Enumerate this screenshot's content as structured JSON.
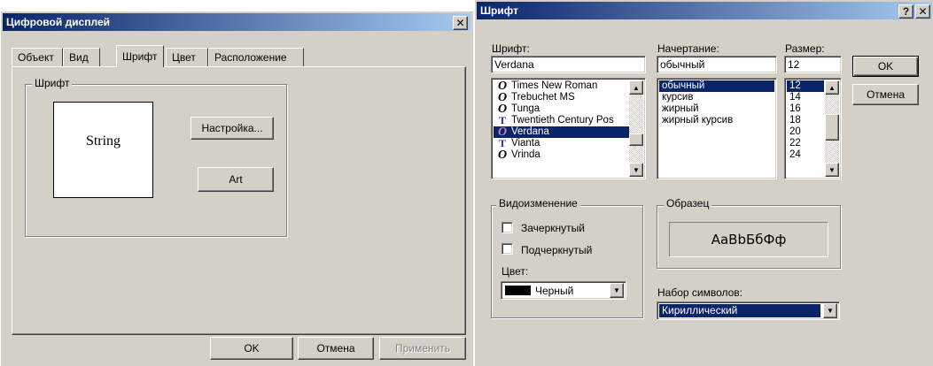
{
  "left_dialog": {
    "title": "Цифровой дисплей",
    "close_glyph": "✕",
    "tabs": [
      {
        "label": "Объект"
      },
      {
        "label": "Вид"
      },
      {
        "label": "Шрифт"
      },
      {
        "label": "Цвет"
      },
      {
        "label": "Расположение"
      }
    ],
    "active_tab": "Шрифт",
    "group_label": "Шрифт",
    "preview_text": "String",
    "setup_button": "Настройка...",
    "art_button": "Art",
    "ok_button": "OK",
    "cancel_button": "Отмена",
    "apply_button": "Применить"
  },
  "right_dialog": {
    "title": "Шрифт",
    "help_glyph": "?",
    "close_glyph": "✕",
    "font_label": "Шрифт:",
    "font_value": "Verdana",
    "fonts": [
      {
        "icon": "O",
        "type": "opentype",
        "name": "Times New Roman"
      },
      {
        "icon": "O",
        "type": "opentype",
        "name": "Trebuchet MS"
      },
      {
        "icon": "O",
        "type": "opentype",
        "name": "Tunga"
      },
      {
        "icon": "T",
        "type": "truetype",
        "name": "Twentieth Century Pos"
      },
      {
        "icon": "O",
        "type": "opentype",
        "name": "Verdana"
      },
      {
        "icon": "T",
        "type": "truetype",
        "name": "Vianta"
      },
      {
        "icon": "O",
        "type": "opentype",
        "name": "Vrinda"
      }
    ],
    "selected_font": "Verdana",
    "style_label": "Начертание:",
    "style_value": "обычный",
    "styles": [
      "обычный",
      "курсив",
      "жирный",
      "жирный курсив"
    ],
    "selected_style": "обычный",
    "size_label": "Размер:",
    "size_value": "12",
    "sizes": [
      "12",
      "14",
      "16",
      "18",
      "20",
      "22",
      "24"
    ],
    "selected_size": "12",
    "ok_button": "OK",
    "cancel_button": "Отмена",
    "effects_label": "Видоизменение",
    "strikeout_label": "Зачеркнутый",
    "underline_label": "Подчеркнутый",
    "color_label": "Цвет:",
    "color_value": "Черный",
    "color_swatch": "#000000",
    "sample_label": "Образец",
    "sample_text": "AaBbБбФф",
    "charset_label": "Набор символов:",
    "charset_value": "Кириллический"
  },
  "colors": {
    "titlebar_start": "#0a246a",
    "titlebar_end": "#a6caf0",
    "face": "#d4d0c8",
    "selection": "#0a246a"
  }
}
